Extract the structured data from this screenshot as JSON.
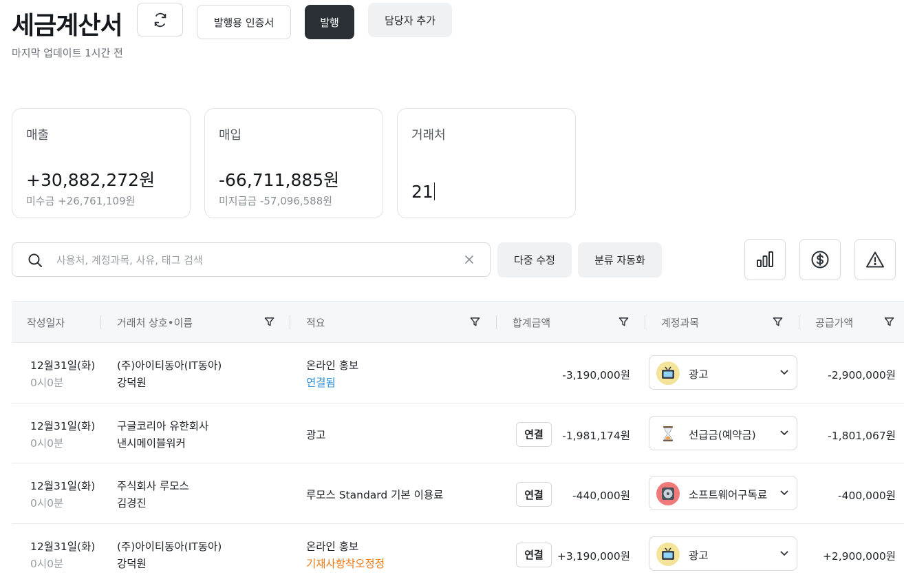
{
  "header": {
    "title": "세금계산서",
    "last_update": "마지막 업데이트 1시간 전",
    "refresh_icon": "refresh-icon",
    "cert_label": "발행용 인증서",
    "issue_label": "발행",
    "add_manager_label": "담당자 추가"
  },
  "summary": {
    "sales": {
      "label": "매출",
      "value": "+30,882,272원",
      "sub": "미수금 +26,761,109원"
    },
    "purchase": {
      "label": "매입",
      "value": "-66,711,885원",
      "sub": "미지급금 -57,096,588원"
    },
    "partners": {
      "label": "거래처",
      "value": "21"
    }
  },
  "toolbar": {
    "search_placeholder": "사용처, 계정과목, 사유, 태그 검색",
    "search_value": "",
    "multi_edit_label": "다중 수정",
    "auto_classify_label": "분류 자동화",
    "icons": [
      "bar-chart-icon",
      "dollar-icon",
      "warning-icon"
    ]
  },
  "table": {
    "columns": {
      "date": "작성일자",
      "partner": "거래처 상호•이름",
      "memo": "적요",
      "total": "합계금액",
      "account": "계정과목",
      "supply": "공급가액"
    },
    "rows": [
      {
        "date": "12월31일(화)",
        "time": "0시0분",
        "company": "(주)아이티동아(IT동아)",
        "person": "강덕원",
        "memo": "온라인 홍보",
        "memo_status": "연결됨",
        "status_color": "#2f8fd8",
        "link_label": "",
        "total": "-3,190,000원",
        "account": "광고",
        "account_icon": "tv-icon",
        "icon_bg": "#f3e49a",
        "supply": "-2,900,000원"
      },
      {
        "date": "12월31일(화)",
        "time": "0시0분",
        "company": "구글코리아 유한회사",
        "person": "낸시메이블워커",
        "memo": "광고",
        "memo_status": "",
        "status_color": "",
        "link_label": "연결",
        "total": "-1,981,174원",
        "account": "선급금(예약금)",
        "account_icon": "hourglass-icon",
        "icon_bg": "#ffffff",
        "supply": "-1,801,067원"
      },
      {
        "date": "12월31일(화)",
        "time": "0시0분",
        "company": "주식회사 루모스",
        "person": "김경진",
        "memo": "루모스 Standard 기본 이용료",
        "memo_status": "",
        "status_color": "",
        "link_label": "연결",
        "total": "-440,000원",
        "account": "소프트웨어구독료",
        "account_icon": "disc-icon",
        "icon_bg": "#f07a7a",
        "supply": "-400,000원"
      },
      {
        "date": "12월31일(화)",
        "time": "0시0분",
        "company": "(주)아이티동아(IT동아)",
        "person": "강덕원",
        "memo": "온라인 홍보",
        "memo_status": "기재사항착오정정",
        "status_color": "#f07b16",
        "link_label": "연결",
        "total": "+3,190,000원",
        "account": "광고",
        "account_icon": "tv-icon",
        "icon_bg": "#f3e49a",
        "supply": "+2,900,000원"
      }
    ]
  }
}
